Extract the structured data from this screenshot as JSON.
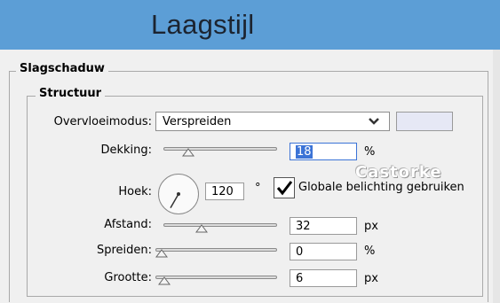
{
  "window": {
    "title": "Laagstijl"
  },
  "sections": {
    "outer": "Slagschaduw",
    "inner": "Structuur"
  },
  "blend": {
    "label": "Overvloeimodus:",
    "value": "Verspreiden",
    "color": "#e6e8f5"
  },
  "opacity": {
    "label": "Dekking:",
    "value": "18",
    "unit": "%",
    "level": 0.18
  },
  "angle": {
    "label": "Hoek:",
    "value": "120",
    "unit": "°",
    "degrees": 120
  },
  "global_light": {
    "label": "Globale belichting gebruiken",
    "checked": true
  },
  "distance": {
    "label": "Afstand:",
    "value": "32",
    "unit": "px",
    "level": 0.32
  },
  "spread": {
    "label": "Spreiden:",
    "value": "0",
    "unit": "%",
    "level": 0
  },
  "size": {
    "label": "Grootte:",
    "value": "6",
    "unit": "px",
    "level": 0.024
  },
  "watermark": "Castorke",
  "colors": {
    "titlebar": "#5c9ed6",
    "selection": "#3b73d6"
  }
}
